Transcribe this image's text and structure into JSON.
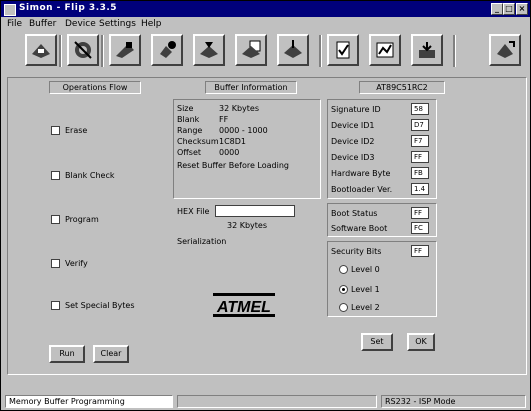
{
  "titlebar": {
    "title": "Simon - Flip 3.3.5",
    "minimize": "_",
    "maximize": "□",
    "close": "×"
  },
  "menu": {
    "items": [
      "File",
      "Buffer",
      "Device",
      "Settings",
      "Help"
    ]
  },
  "toolbar": {
    "buttons": [
      {
        "icon": "chip-icon"
      },
      {
        "icon": "device-select-icon"
      },
      {
        "icon": "open-file-icon"
      },
      {
        "icon": "load-buffer-icon"
      },
      {
        "icon": "erase-icon"
      },
      {
        "icon": "blank-check-icon"
      },
      {
        "icon": "program-icon"
      },
      {
        "icon": "verify-icon"
      },
      {
        "icon": "read-icon"
      },
      {
        "icon": "auto-icon"
      },
      {
        "icon": "exit-icon"
      }
    ]
  },
  "left_panel": {
    "header": "Operations Flow",
    "options": [
      {
        "label": "Erase",
        "checked": false
      },
      {
        "label": "Blank Check",
        "checked": false
      },
      {
        "label": "Program",
        "checked": false
      },
      {
        "label": "Verify",
        "checked": false
      }
    ],
    "run_option": "Set Special Bytes",
    "run_button": "Run",
    "clear_button": "Clear"
  },
  "center_panel": {
    "header": "Buffer Information",
    "info": [
      {
        "key": "Size",
        "value": "32 Kbytes"
      },
      {
        "key": "Blank",
        "value": "FF"
      },
      {
        "key": "Range",
        "value": "0000 - 1000"
      },
      {
        "key": "Checksum",
        "value": "1C8D1"
      },
      {
        "key": "Offset",
        "value": "0000"
      }
    ],
    "reset_line": "Reset Buffer Before Loading",
    "hex_file_label": "HEX File",
    "hex_file_value": "",
    "hex_size": "32 Kbytes",
    "extra_label": "Serialization",
    "logo_text": "ATMEL"
  },
  "right_panel": {
    "header": "AT89C51RC2",
    "rows": [
      {
        "label": "Signature ID",
        "value": "58"
      },
      {
        "label": "Device ID1",
        "value": "D7"
      },
      {
        "label": "Device ID2",
        "value": "F7"
      },
      {
        "label": "Device ID3",
        "value": "FF"
      },
      {
        "label": "Hardware Byte",
        "value": "FB"
      },
      {
        "label": "Bootloader Ver.",
        "value": "1.4"
      }
    ],
    "bsb_rows": [
      {
        "label": "Boot Status",
        "value": "FF"
      },
      {
        "label": "Software Boot",
        "value": "FC"
      }
    ],
    "lock_label": "Security Bits",
    "lock_value": "FF",
    "lock_levels": [
      "Level 0",
      "Level 1",
      "Level 2"
    ],
    "lock_selected": 1,
    "set_button": "Set",
    "ok_button": "OK"
  },
  "status": {
    "left": "Memory Buffer Programming",
    "right": "RS232 - ISP Mode"
  }
}
